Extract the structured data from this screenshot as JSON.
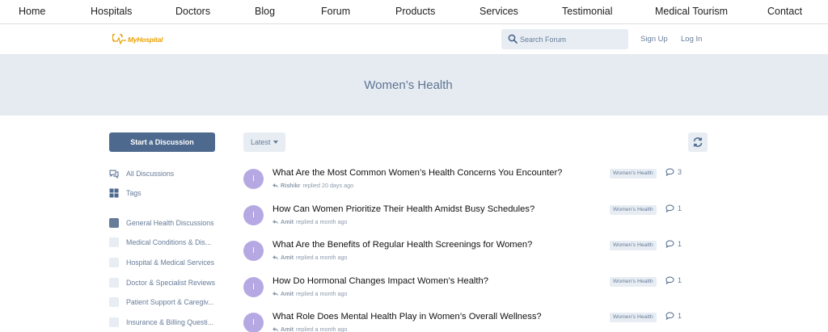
{
  "topnav": [
    {
      "label": "Home"
    },
    {
      "label": "Hospitals"
    },
    {
      "label": "Doctors"
    },
    {
      "label": "Blog"
    },
    {
      "label": "Forum"
    },
    {
      "label": "Products"
    },
    {
      "label": "Services"
    },
    {
      "label": "Testimonial"
    },
    {
      "label": "Medical Tourism"
    },
    {
      "label": "Contact"
    }
  ],
  "header": {
    "logo_text": "MyHospital",
    "search_placeholder": "Search Forum",
    "sign_up": "Sign Up",
    "log_in": "Log In"
  },
  "hero": {
    "title": "Women’s Health"
  },
  "sidebar": {
    "start_button": "Start a Discussion",
    "nav": [
      {
        "label": "All Discussions",
        "icon": "chat-bubbles-icon"
      },
      {
        "label": "Tags",
        "icon": "grid-icon"
      }
    ],
    "tags": [
      {
        "label": "General Health Discussions",
        "color": "#667c99"
      },
      {
        "label": "Medical Conditions & Dis...",
        "color": "#e7edf3"
      },
      {
        "label": "Hospital & Medical Services",
        "color": "#e7edf3"
      },
      {
        "label": "Doctor & Specialist Reviews",
        "color": "#e7edf3"
      },
      {
        "label": "Patient Support & Caregiv...",
        "color": "#e7edf3"
      },
      {
        "label": "Insurance & Billing Questi...",
        "color": "#e7edf3"
      }
    ]
  },
  "toolbar": {
    "sort_label": "Latest",
    "refresh_icon": "refresh-icon"
  },
  "discussions": [
    {
      "avatar": "I",
      "title": "What Are the Most Common Women’s Health Concerns You Encounter?",
      "user": "Rishikr",
      "action": "replied 20 days ago",
      "tag": "Women’s Health",
      "replies": "3"
    },
    {
      "avatar": "I",
      "title": "How Can Women Prioritize Their Health Amidst Busy Schedules?",
      "user": "Amit",
      "action": "replied a month ago",
      "tag": "Women’s Health",
      "replies": "1"
    },
    {
      "avatar": "I",
      "title": "What Are the Benefits of Regular Health Screenings for Women?",
      "user": "Amit",
      "action": "replied a month ago",
      "tag": "Women’s Health",
      "replies": "1"
    },
    {
      "avatar": "I",
      "title": "How Do Hormonal Changes Impact Women’s Health?",
      "user": "Amit",
      "action": "replied a month ago",
      "tag": "Women’s Health",
      "replies": "1"
    },
    {
      "avatar": "I",
      "title": "What Role Does Mental Health Play in Women’s Overall Wellness?",
      "user": "Amit",
      "action": "replied a month ago",
      "tag": "Women’s Health",
      "replies": "1"
    }
  ],
  "colors": {
    "accent": "#4d698e",
    "muted": "#667c99",
    "hero_bg": "#e6ebf1",
    "avatar": "#b6a8e3"
  }
}
